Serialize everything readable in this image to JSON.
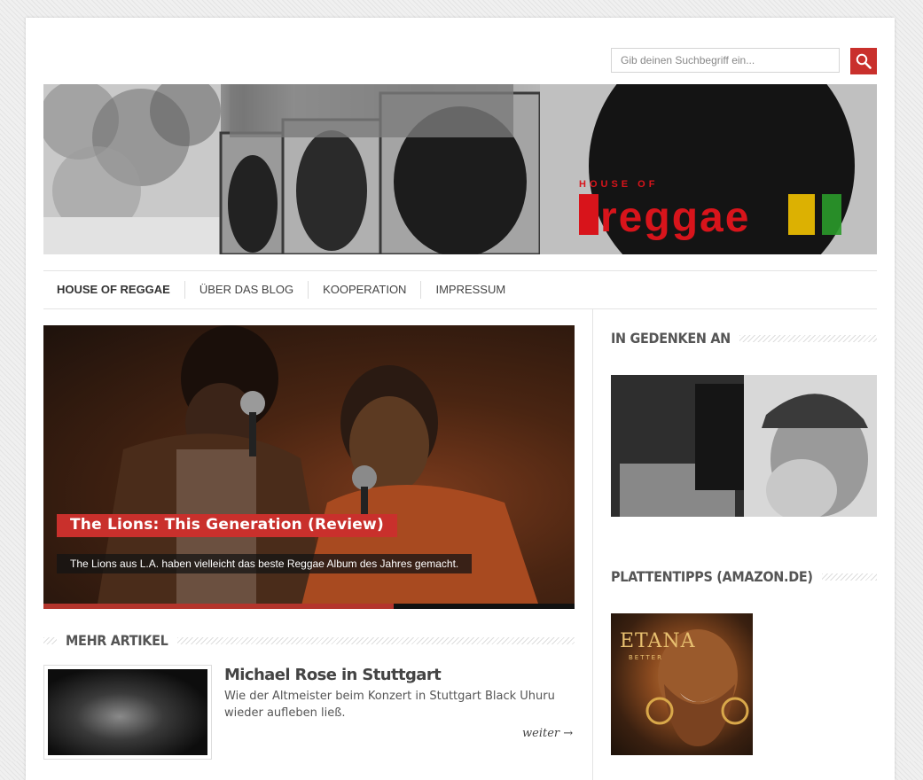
{
  "search": {
    "placeholder": "Gib deinen Suchbegriff ein..."
  },
  "banner": {
    "logo_small": "HOUSE OF",
    "logo_big": "reggae",
    "logo_colors": [
      "#d8141b",
      "#f2c200",
      "#2a9a2a"
    ]
  },
  "nav": {
    "items": [
      {
        "label": "HOUSE OF REGGAE",
        "active": true
      },
      {
        "label": "ÜBER DAS BLOG",
        "active": false
      },
      {
        "label": "KOOPERATION",
        "active": false
      },
      {
        "label": "IMPRESSUM",
        "active": false
      }
    ]
  },
  "slider": {
    "title": "The Lions: This Generation (Review)",
    "excerpt": "The Lions aus L.A. haben vielleicht das beste Reggae Album des Jahres gemacht.",
    "progress": 0.66
  },
  "more_articles": {
    "heading": "MEHR ARTIKEL",
    "articles": [
      {
        "title": "Michael Rose in Stuttgart",
        "excerpt": "Wie der Altmeister beim Konzert in Stuttgart Black Uhuru wieder aufleben ließ.",
        "more_label": "weiter →"
      }
    ]
  },
  "sidebar": {
    "memorial_heading": "IN GEDENKEN AN",
    "records_heading": "PLATTENTIPPS (AMAZON.DE)",
    "record_cover_text": "ETANA",
    "record_cover_subtext": "BETTER"
  },
  "colors": {
    "accent": "#c9302c",
    "text": "#444444"
  }
}
